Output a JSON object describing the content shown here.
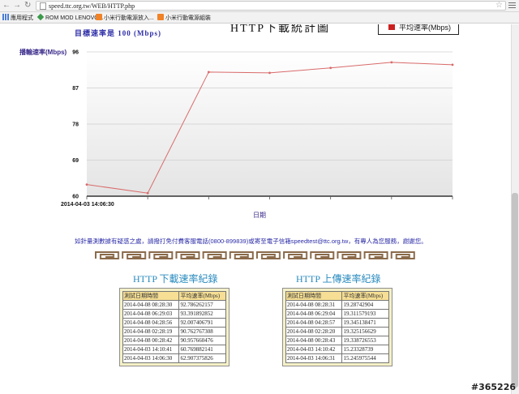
{
  "browser": {
    "url": "speed.ttc.org.tw/WEB/HTTP.php",
    "bookmarks": [
      {
        "label": "應用程式",
        "icon": "apps-grid-icon"
      },
      {
        "label": "ROM MOD LENOVO...",
        "icon": "diamond-icon"
      },
      {
        "label": "小米行動電源放入...",
        "icon": "mi-logo-icon"
      },
      {
        "label": "小米行動電源組裝",
        "icon": "mi-logo-icon"
      }
    ]
  },
  "chart": {
    "title": "HTTP下載統計圖",
    "target_text": "目標速率是 100 (Mbps)",
    "legend_label": "平均速率(Mbps)",
    "y_title": "播輸速率(Mbps)",
    "x_title": "日期",
    "first_x_label": "2014-04-03 14:06:30"
  },
  "chart_data": {
    "type": "line",
    "title": "HTTP下載統計圖",
    "ylabel": "播輸速率(Mbps)",
    "xlabel": "日期",
    "ylim": [
      60,
      96
    ],
    "yticks": [
      60,
      69,
      78,
      87,
      96
    ],
    "x": [
      "2014-04-03 14:06:30",
      "2014-04-03 14:10:41",
      "2014-04-08 00:28:42",
      "2014-04-08 02:28:19",
      "2014-04-08 04:28:56",
      "2014-04-08 06:29:03",
      "2014-04-08 08:28:30"
    ],
    "series": [
      {
        "name": "平均速率(Mbps)",
        "color": "#d96a6a",
        "values": [
          62.907375826,
          60.769882141,
          90.957660476,
          90.762767308,
          92.007406791,
          93.391892852,
          92.786262157
        ]
      }
    ],
    "grid": true,
    "legend": "top-right"
  },
  "notice": "如針量測數據有疑惑之處，請撥打免付費客服電話(0800-899839)或寄至電子信箱speedtest@ttc.org.tw，有專人為您服務，謝謝您。",
  "download": {
    "title": "HTTP 下載速率紀錄",
    "headers": [
      "測試日期時間",
      "平均速率(Mbps)"
    ],
    "rows": [
      [
        "2014-04-08 08:28:30",
        "92.786262157"
      ],
      [
        "2014-04-08 06:29:03",
        "93.391892852"
      ],
      [
        "2014-04-08 04:28:56",
        "92.007406791"
      ],
      [
        "2014-04-08 02:28:19",
        "90.762767308"
      ],
      [
        "2014-04-08 00:28:42",
        "90.957660476"
      ],
      [
        "2014-04-03 14:10:41",
        "60.769882141"
      ],
      [
        "2014-04-03 14:06:30",
        "62.907375826"
      ]
    ]
  },
  "upload": {
    "title": "HTTP 上傳速率紀錄",
    "headers": [
      "測試日期時間",
      "平均速率(Mbps)"
    ],
    "rows": [
      [
        "2014-04-08 08:28:31",
        "19.28742904"
      ],
      [
        "2014-04-08 06:29:04",
        "19.311579193"
      ],
      [
        "2014-04-08 04:28:57",
        "19.345138471"
      ],
      [
        "2014-04-08 02:28:20",
        "19.325156629"
      ],
      [
        "2014-04-08 00:28:43",
        "19.338726553"
      ],
      [
        "2014-04-03 14:10:42",
        "15.23328739"
      ],
      [
        "2014-04-03 14:06:31",
        "15.245975544"
      ]
    ]
  },
  "watermark": "#365226"
}
